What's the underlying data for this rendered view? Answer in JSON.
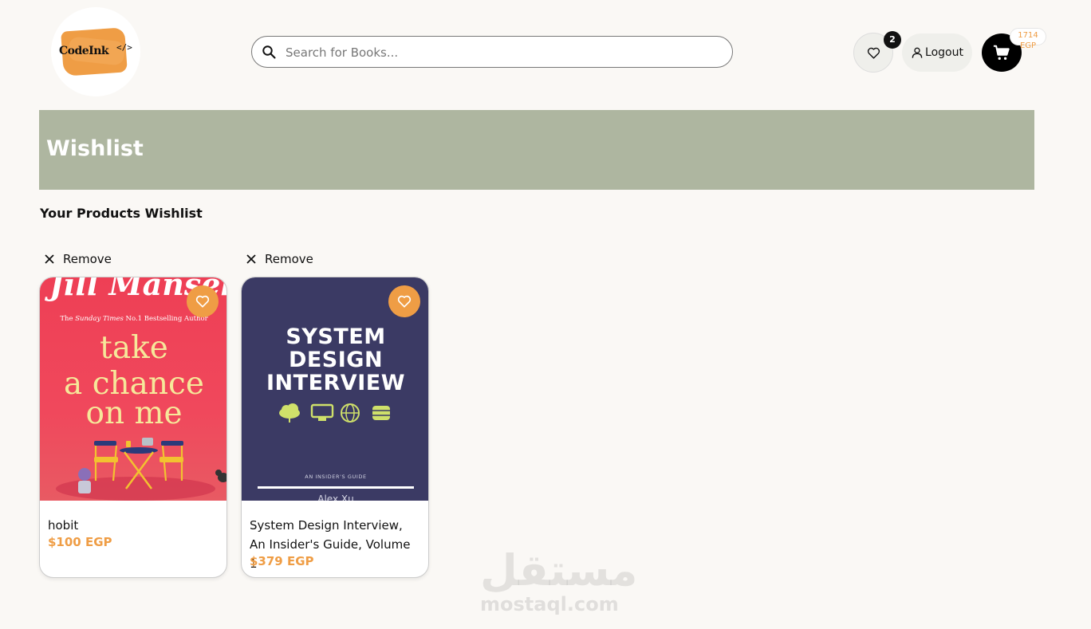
{
  "header": {
    "logo_text": "CodeInk",
    "logo_mark": "</>",
    "search_placeholder": "Search for Books...",
    "wishlist_count": "2",
    "logout_label": "Logout",
    "cart_total": "1714",
    "cart_currency": "EGP"
  },
  "banner": {
    "title": "Wishlist"
  },
  "section": {
    "subtitle": "Your Products Wishlist"
  },
  "products": [
    {
      "remove_label": "Remove",
      "title": "hobit",
      "price": "$100 EGP",
      "cover": {
        "author": "Jill Mansell",
        "tagline_pre": "The",
        "tagline_italic": "Sunday Times",
        "tagline_post": "No.1 Bestselling Author",
        "line1": "take",
        "line2": "a chance",
        "line3": "on me"
      }
    },
    {
      "remove_label": "Remove",
      "title": "System Design Interview, An Insider's Guide, Volume 1",
      "price": "$379 EGP",
      "cover": {
        "line1": "SYSTEM",
        "line2": "DESIGN",
        "line3": "INTERVIEW",
        "guide": "AN INSIDER'S GUIDE",
        "author": "Alex Xu"
      }
    }
  ],
  "watermark": {
    "arabic": "مستقل",
    "latin": "mostaql.com"
  },
  "colors": {
    "accent": "#ef9d45",
    "banner": "#aeb6a0",
    "cover_navy": "#3b3a64",
    "cover_red": "#ee3f55"
  }
}
